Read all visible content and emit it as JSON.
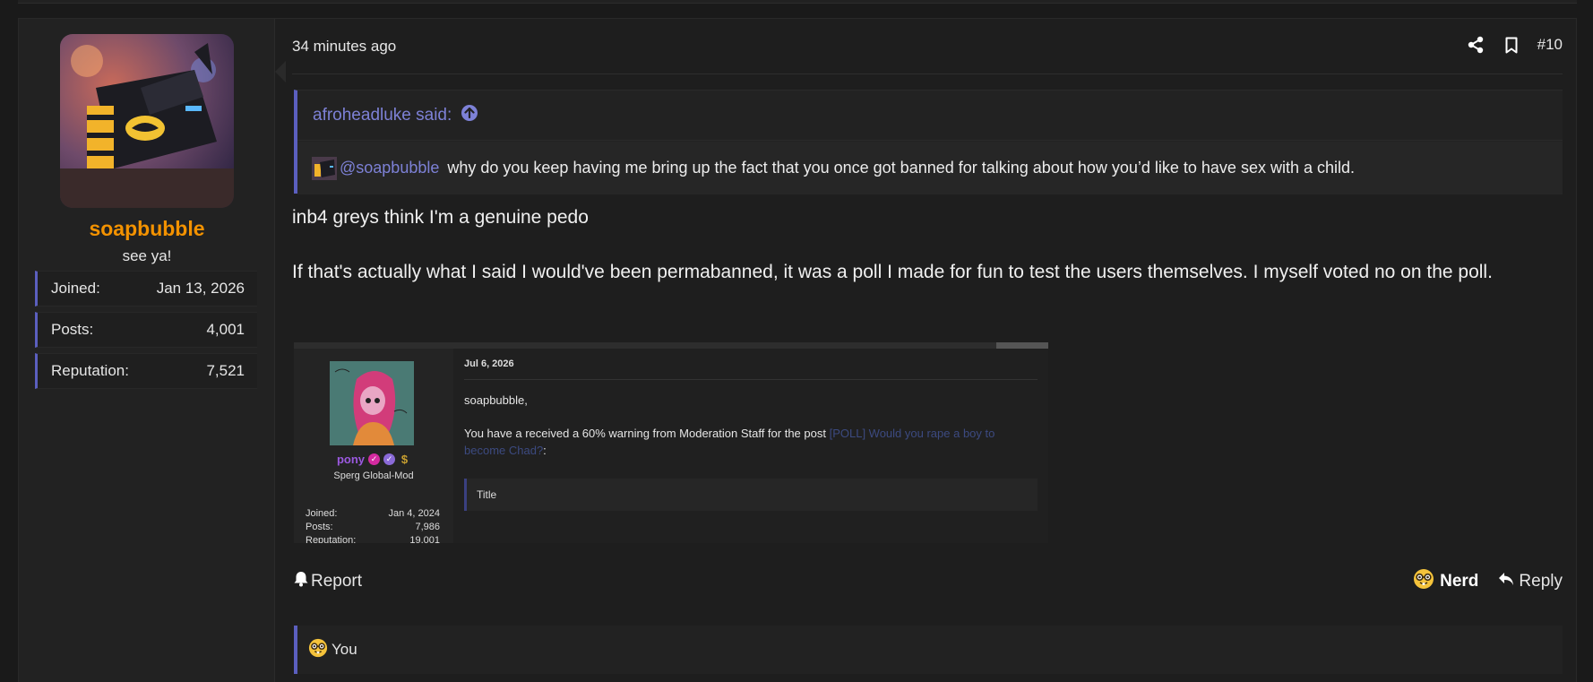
{
  "user": {
    "username": "soapbubble",
    "title": "see ya!",
    "stats": [
      {
        "label": "Joined:",
        "value": "Jan 13, 2026"
      },
      {
        "label": "Posts:",
        "value": "4,001"
      },
      {
        "label": "Reputation:",
        "value": "7,521"
      }
    ]
  },
  "post": {
    "time": "34 minutes ago",
    "number": "#10",
    "quote": {
      "author": "afroheadluke said:",
      "mention": "@soapbubble",
      "text": "why do you keep having me bring up the fact that you once got banned for talking about how you’d like to have sex with a child."
    },
    "body": [
      "inb4 greys think I'm a genuine pedo",
      "If that's actually what I said I would've been permabanned, it was a poll I made for fun to test the users themselves. I myself voted no on the poll."
    ],
    "embedded": {
      "date": "Jul 6, 2026",
      "username": "pony",
      "role": "Sperg Global-Mod",
      "stats": [
        {
          "label": "Joined:",
          "value": "Jan 4, 2024"
        },
        {
          "label": "Posts:",
          "value": "7,986"
        },
        {
          "label": "Reputation:",
          "value": "19,001"
        }
      ],
      "greeting": "soapbubble,",
      "message": "You have a received a 60% warning from Moderation Staff for the post",
      "link": "[POLL] Would you rape a boy to become Chad?",
      "link_suffix": ":",
      "box_title": "Title"
    },
    "actions": {
      "report": "Report",
      "reaction": "Nerd",
      "reply": "Reply"
    },
    "reactions_by": "You"
  },
  "colors": {
    "accent": "#5b5fbf",
    "username": "#f39200",
    "link": "#7d81d6"
  }
}
